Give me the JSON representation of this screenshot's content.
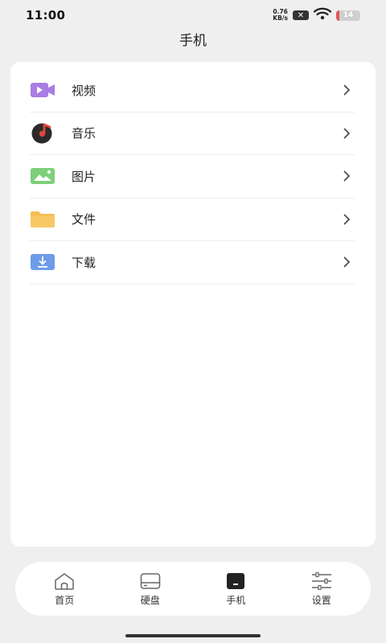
{
  "status_bar": {
    "time": "11:00",
    "net_speed_value": "0.76",
    "net_speed_unit": "KB/s",
    "x_badge": "✕",
    "battery_level": "14",
    "battery_fraction": 0.14
  },
  "header": {
    "title": "手机"
  },
  "list": {
    "items": [
      {
        "label": "视频",
        "icon": "video-icon"
      },
      {
        "label": "音乐",
        "icon": "music-icon"
      },
      {
        "label": "图片",
        "icon": "image-icon"
      },
      {
        "label": "文件",
        "icon": "folder-icon"
      },
      {
        "label": "下载",
        "icon": "download-icon"
      }
    ]
  },
  "bottom_nav": {
    "items": [
      {
        "label": "首页",
        "icon": "home-icon",
        "active": false
      },
      {
        "label": "硬盘",
        "icon": "disk-icon",
        "active": false
      },
      {
        "label": "手机",
        "icon": "phone-icon",
        "active": true
      },
      {
        "label": "设置",
        "icon": "settings-icon",
        "active": false
      }
    ]
  },
  "colors": {
    "video": "#a97ce6",
    "music_disc": "#2a2a2a",
    "music_note": "#e2463b",
    "image": "#7dd07a",
    "folder": "#f5bf55",
    "download": "#6d9ce8",
    "battery_low": "#e35656"
  }
}
